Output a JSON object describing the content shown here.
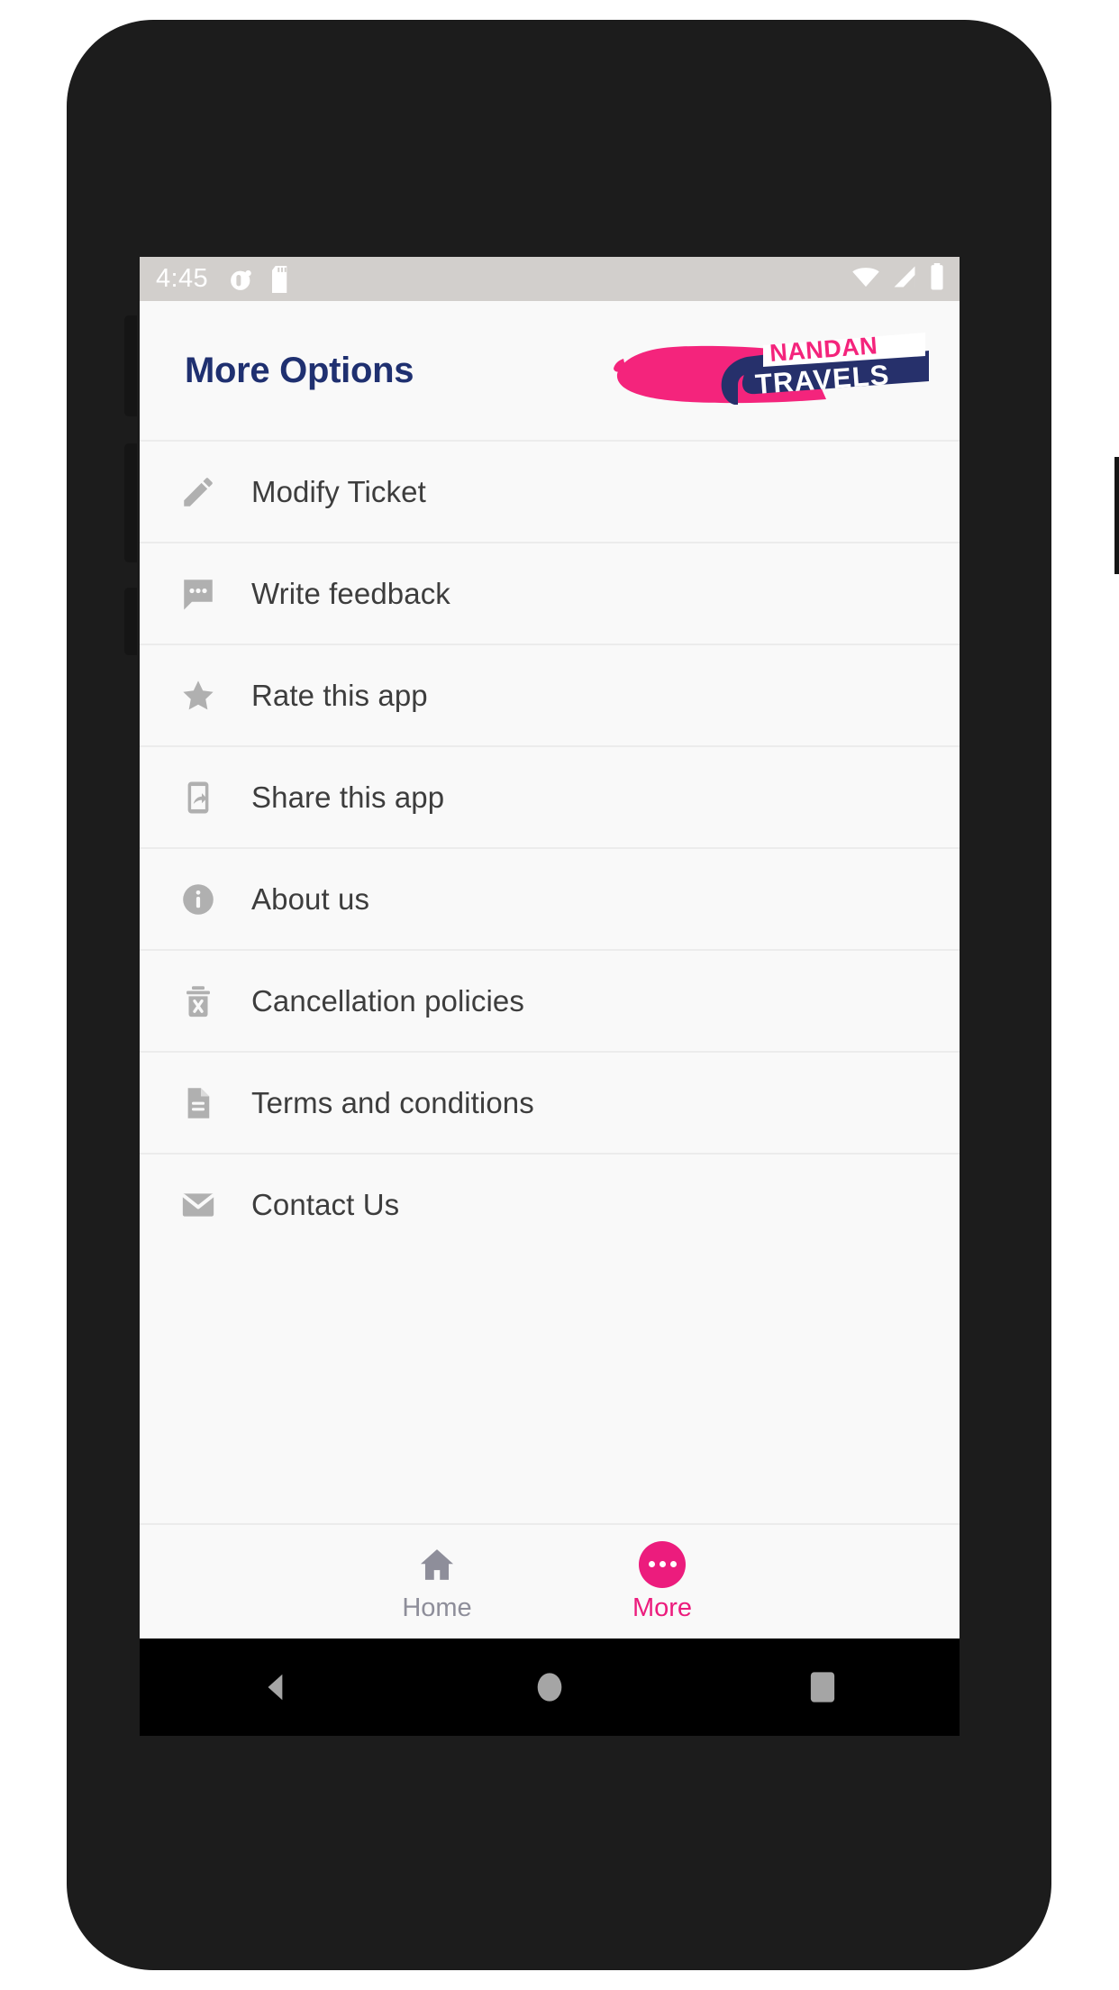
{
  "status_bar": {
    "time": "4:45",
    "left_icons": [
      "notification-dot-icon",
      "sd-card-icon"
    ],
    "right_icons": [
      "wifi-icon",
      "cellular-signal-icon",
      "battery-icon"
    ]
  },
  "header": {
    "title": "More Options",
    "logo": {
      "name_top": "NANDAN",
      "name_bottom": "TRAVELS",
      "brush_color": "#f4247c",
      "bus_color": "#26306b"
    }
  },
  "menu": {
    "items": [
      {
        "label": "Modify Ticket",
        "icon": "pencil-icon"
      },
      {
        "label": "Write feedback",
        "icon": "chat-bubble-icon"
      },
      {
        "label": "Rate this app",
        "icon": "star-icon"
      },
      {
        "label": "Share this app",
        "icon": "phone-share-icon"
      },
      {
        "label": "About us",
        "icon": "info-circle-icon"
      },
      {
        "label": "Cancellation policies",
        "icon": "trash-x-icon"
      },
      {
        "label": "Terms and conditions",
        "icon": "document-icon"
      },
      {
        "label": "Contact Us",
        "icon": "envelope-icon"
      }
    ]
  },
  "bottom_nav": {
    "tabs": [
      {
        "label": "Home",
        "icon": "home-icon",
        "active": false
      },
      {
        "label": "More",
        "icon": "more-dots-icon",
        "active": true
      }
    ],
    "active_color": "#ec1c7d",
    "inactive_color": "#8e8e9a"
  },
  "android_nav": {
    "buttons": [
      "back-triangle-icon",
      "home-circle-icon",
      "recents-square-icon"
    ]
  },
  "colors": {
    "title": "#1f3070",
    "accent_pink": "#ec1c7d",
    "list_bg": "#f9f9f9",
    "icon_grey": "#b0b0b0",
    "divider": "#ececec",
    "status_bar_bg": "#d2cfcc"
  }
}
